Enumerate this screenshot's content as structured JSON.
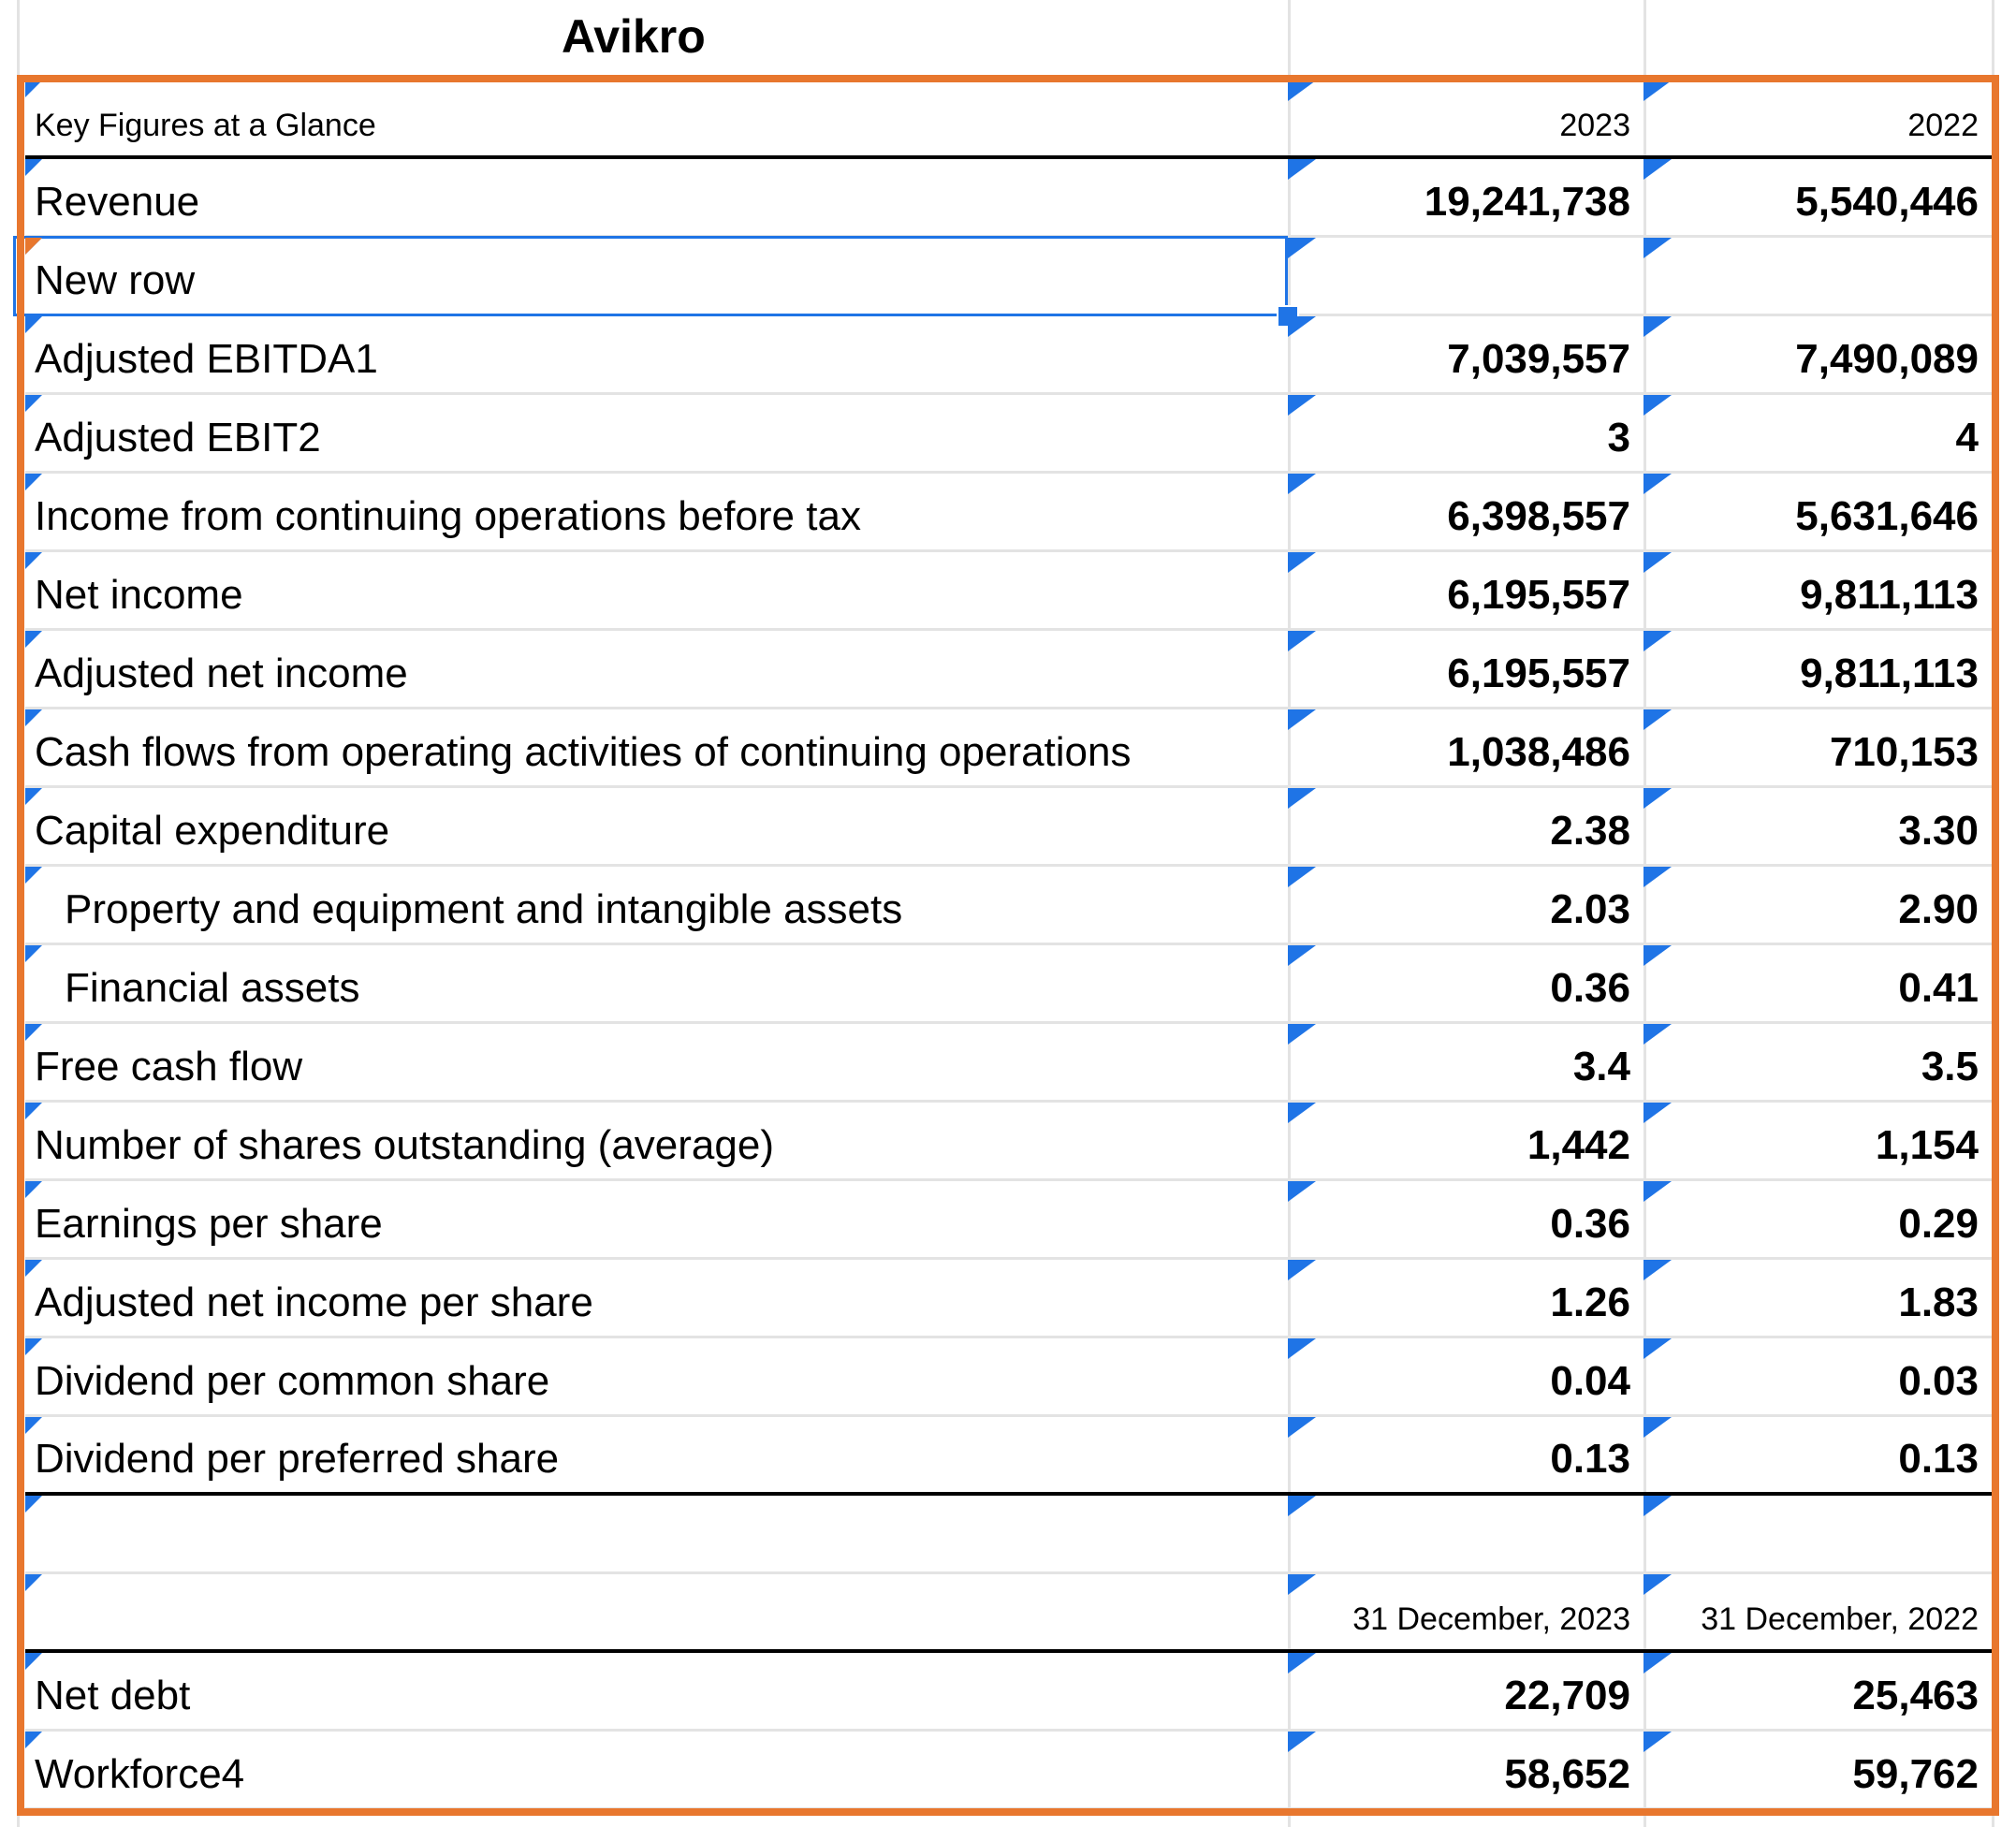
{
  "title": "Avikro",
  "header": {
    "label": "Key Figures at a Glance",
    "col1": "2023",
    "col2": "2022"
  },
  "rows": [
    {
      "label": "Revenue",
      "v1": "19,241,738",
      "v2": "5,540,446"
    },
    {
      "label": "New row",
      "v1": "",
      "v2": ""
    },
    {
      "label": "Adjusted EBITDA1",
      "v1": "7,039,557",
      "v2": "7,490,089"
    },
    {
      "label": "Adjusted EBIT2",
      "v1": "3",
      "v2": "4"
    },
    {
      "label": "Income from continuing operations before tax",
      "v1": "6,398,557",
      "v2": "5,631,646"
    },
    {
      "label": "Net income",
      "v1": "6,195,557",
      "v2": "9,811,113"
    },
    {
      "label": "Adjusted net income",
      "v1": "6,195,557",
      "v2": "9,811,113"
    },
    {
      "label": "Cash flows from operating activities of continuing operations",
      "v1": "1,038,486",
      "v2": "710,153"
    },
    {
      "label": "Capital expenditure",
      "v1": "2.38",
      "v2": "3.30"
    },
    {
      "label": "Property and equipment and intangible assets",
      "v1": "2.03",
      "v2": "2.90"
    },
    {
      "label": "Financial assets",
      "v1": "0.36",
      "v2": "0.41"
    },
    {
      "label": "Free cash flow",
      "v1": "3.4",
      "v2": "3.5"
    },
    {
      "label": "Number of shares outstanding (average)",
      "v1": "1,442",
      "v2": "1,154"
    },
    {
      "label": "Earnings per share",
      "v1": "0.36",
      "v2": "0.29"
    },
    {
      "label": "Adjusted net income per share",
      "v1": "1.26",
      "v2": "1.83"
    },
    {
      "label": "Dividend per common share",
      "v1": "0.04",
      "v2": "0.03"
    },
    {
      "label": "Dividend per preferred share",
      "v1": "0.13",
      "v2": "0.13"
    },
    {
      "label": "",
      "v1": "",
      "v2": ""
    },
    {
      "label": "",
      "v1": "31 December, 2023",
      "v2": "31 December, 2022"
    },
    {
      "label": "Net debt",
      "v1": "22,709",
      "v2": "25,463"
    },
    {
      "label": "Workforce4",
      "v1": "58,652",
      "v2": "59,762"
    }
  ],
  "colors": {
    "frame": "#e8772e",
    "selection": "#1f74e6",
    "note_marker": "#1f74e6",
    "gridline": "#e3e3e3"
  },
  "icons": [
    "comment-marker-icon"
  ]
}
